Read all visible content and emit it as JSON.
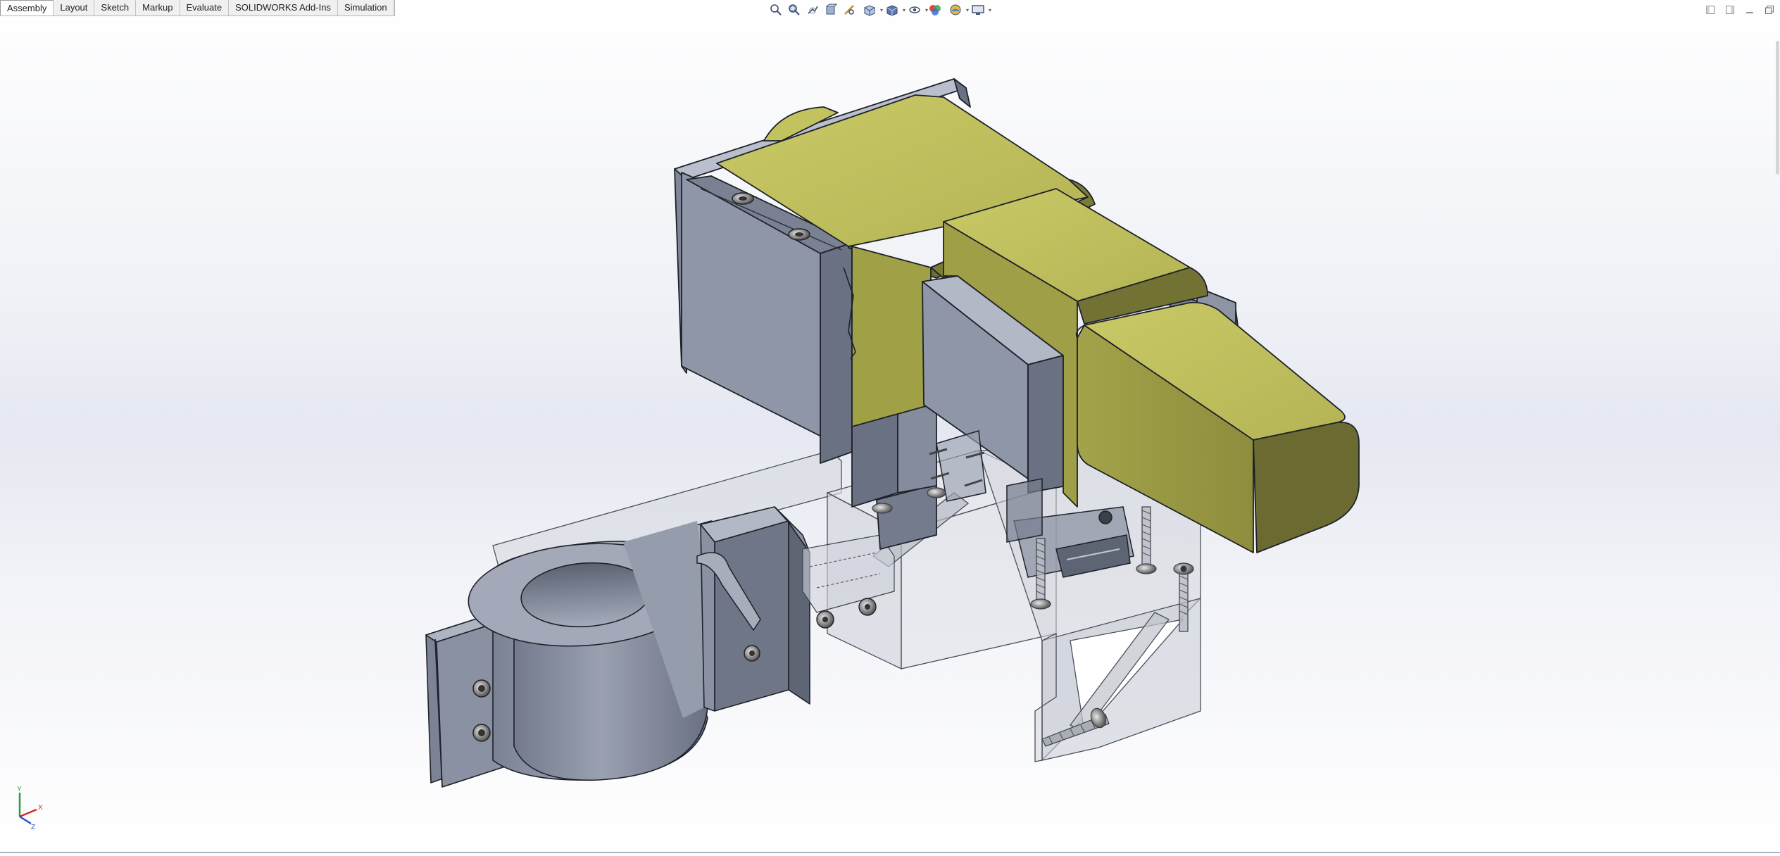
{
  "command_manager": {
    "tabs": [
      "Assembly",
      "Layout",
      "Sketch",
      "Markup",
      "Evaluate",
      "SOLIDWORKS Add-Ins",
      "Simulation"
    ],
    "active_tab": "Assembly"
  },
  "heads_up_toolbar": {
    "icons": [
      "zoom-to-fit-icon",
      "zoom-to-area-icon",
      "previous-view-icon",
      "section-view-icon",
      "dynamic-annotation-icon",
      "view-orientation-icon",
      "display-style-icon",
      "hide-show-items-icon",
      "edit-appearance-icon",
      "apply-scene-icon",
      "view-settings-icon"
    ]
  },
  "window_controls": {
    "icons": [
      "restore-left-icon",
      "restore-right-icon",
      "minimize-icon",
      "maximize-icon"
    ]
  },
  "triad": {
    "x_label": "X",
    "y_label": "Y",
    "z_label": "Z"
  },
  "colors": {
    "part_gray": "#8e96a8",
    "part_gray_dark": "#5f6676",
    "motor_yellow": "#b8b857",
    "motor_yellow_dark": "#6a6a32",
    "transparent_part": "#c9ccd6"
  }
}
